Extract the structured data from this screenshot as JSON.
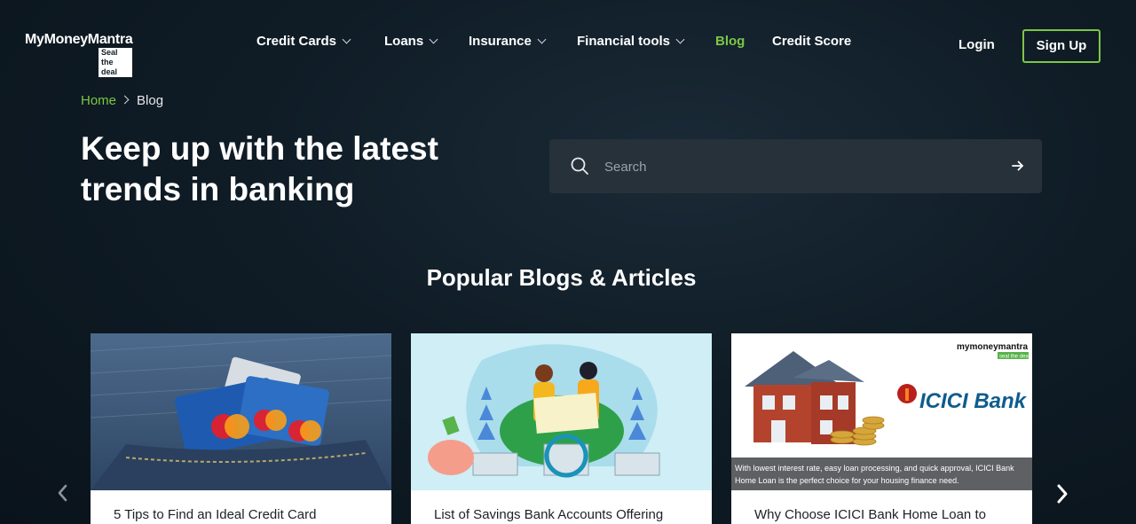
{
  "header": {
    "logo_name": "MyMoneyMantra",
    "logo_tagline": "Seal the deal",
    "nav": [
      {
        "label": "Credit Cards",
        "has_dropdown": true
      },
      {
        "label": "Loans",
        "has_dropdown": true
      },
      {
        "label": "Insurance",
        "has_dropdown": true
      },
      {
        "label": "Financial tools",
        "has_dropdown": true
      },
      {
        "label": "Blog",
        "active": true
      },
      {
        "label": "Credit Score"
      }
    ],
    "login_label": "Login",
    "signup_label": "Sign Up"
  },
  "breadcrumb": {
    "home": "Home",
    "current": "Blog"
  },
  "hero": {
    "title_line1": "Keep up with the latest",
    "title_line2": "trends in banking"
  },
  "search": {
    "placeholder": "Search"
  },
  "popular": {
    "title": "Popular Blogs & Articles",
    "cards": [
      {
        "title": "5 Tips to Find an Ideal Credit Card",
        "image": "credit-cards-in-jeans-pocket"
      },
      {
        "title": "List of Savings Bank Accounts Offering",
        "image": "couple-with-piggy-bank-and-bank-buildings"
      },
      {
        "title": "Why Choose ICICI Bank Home Loan to",
        "image": "icici-bank-home-loan-banner",
        "image_brand": "mymoneymantra",
        "image_brand_tag": "seal the deal",
        "image_logo_text": "ICICI Bank",
        "image_caption_line1": "With lowest interest rate, easy loan processing, and quick approval, ICICI Bank",
        "image_caption_line2": "Home Loan is the perfect choice for your housing finance need."
      }
    ]
  },
  "colors": {
    "accent": "#7cc744",
    "background": "#0f1c26",
    "search_bg": "#26313a"
  }
}
